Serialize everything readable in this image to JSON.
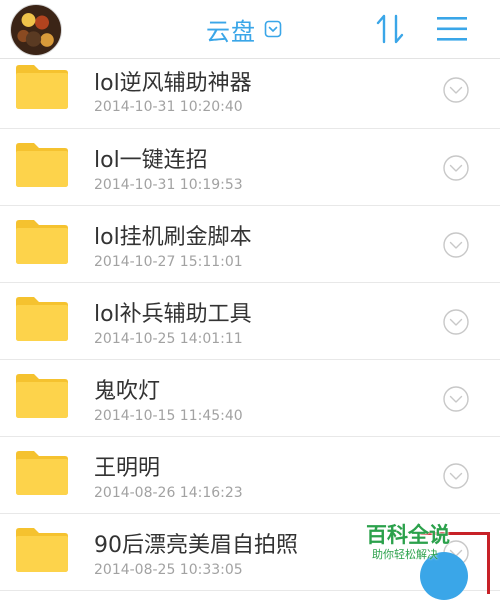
{
  "header": {
    "title": "云盘",
    "title_dropdown_icon": "chevron-down-box-icon",
    "sort_icon": "sort-arrows-icon",
    "menu_icon": "hamburger-menu-icon",
    "accent_color": "#3aa6e8"
  },
  "files": [
    {
      "name": "lol逆风辅助神器",
      "date": "2014-10-31 10:20:40"
    },
    {
      "name": "lol一键连招",
      "date": "2014-10-31 10:19:53"
    },
    {
      "name": "lol挂机刷金脚本",
      "date": "2014-10-27 15:11:01"
    },
    {
      "name": "lol补兵辅助工具",
      "date": "2014-10-25 14:01:11"
    },
    {
      "name": "鬼吹灯",
      "date": "2014-10-15 11:45:40"
    },
    {
      "name": "王明明",
      "date": "2014-08-26 14:16:23"
    },
    {
      "name": "90后漂亮美眉自拍照",
      "date": "2014-08-25 10:33:05"
    }
  ],
  "watermark": {
    "title": "百科全说",
    "subtitle": "助你轻松解决",
    "title_color": "#2ba14b",
    "frame_color": "#c72127"
  },
  "colors": {
    "folder": "#fdd34b",
    "folder_tab": "#f5c22f",
    "name_text": "#333333",
    "date_text": "#a2a2a2"
  }
}
